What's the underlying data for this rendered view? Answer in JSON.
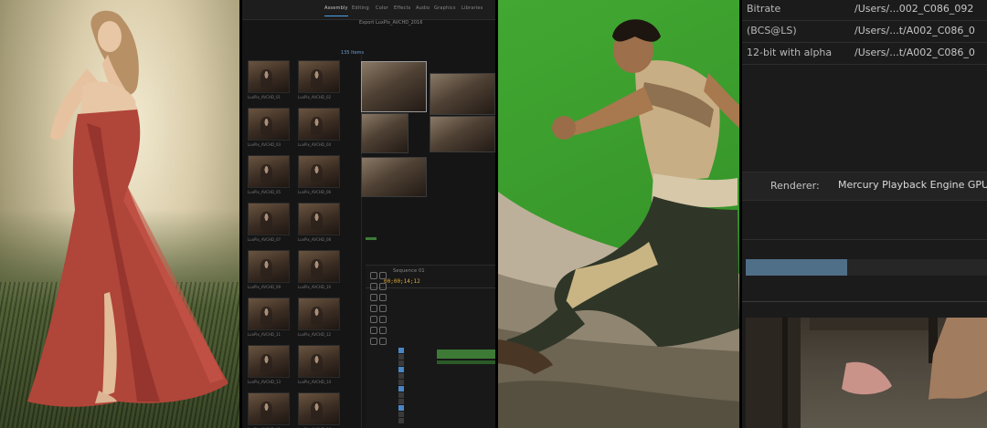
{
  "editor": {
    "tabs": [
      "Assembly",
      "Editing",
      "Color",
      "Effects",
      "Audio",
      "Graphics",
      "Libraries"
    ],
    "project_title": "Export LuxPix_AVCHD_2016",
    "bin_label": "135 Items",
    "clips": [
      "LuxPix_AVCHD_01",
      "LuxPix_AVCHD_02",
      "LuxPix_AVCHD_03",
      "LuxPix_AVCHD_04",
      "LuxPix_AVCHD_05",
      "LuxPix_AVCHD_06",
      "LuxPix_AVCHD_07",
      "LuxPix_AVCHD_08",
      "LuxPix_AVCHD_09",
      "LuxPix_AVCHD_10",
      "LuxPix_AVCHD_11",
      "LuxPix_AVCHD_12",
      "LuxPix_AVCHD_13",
      "LuxPix_AVCHD_14",
      "LuxPix_AVCHD_15",
      "LuxPix_AVCHD_16"
    ],
    "timeline_tab": "Sequence 01",
    "timecode": "00;00;14;12"
  },
  "settings": {
    "rows": [
      {
        "label": "Bitrate",
        "path": "/Users/...002_C086_092"
      },
      {
        "label": "(BCS@LS)",
        "path": "/Users/...t/A002_C086_0"
      },
      {
        "label": "12-bit with alpha",
        "path": "/Users/...t/A002_C086_0"
      }
    ],
    "renderer_label": "Renderer:",
    "renderer_value": "Mercury Playback Engine GPU",
    "progress": 0.42
  },
  "colors": {
    "accent_blue": "#4aa0e8",
    "timecode": "#d9a93b",
    "green_screen": "#3a9a2c",
    "progress_fill": "#4f6f88"
  }
}
